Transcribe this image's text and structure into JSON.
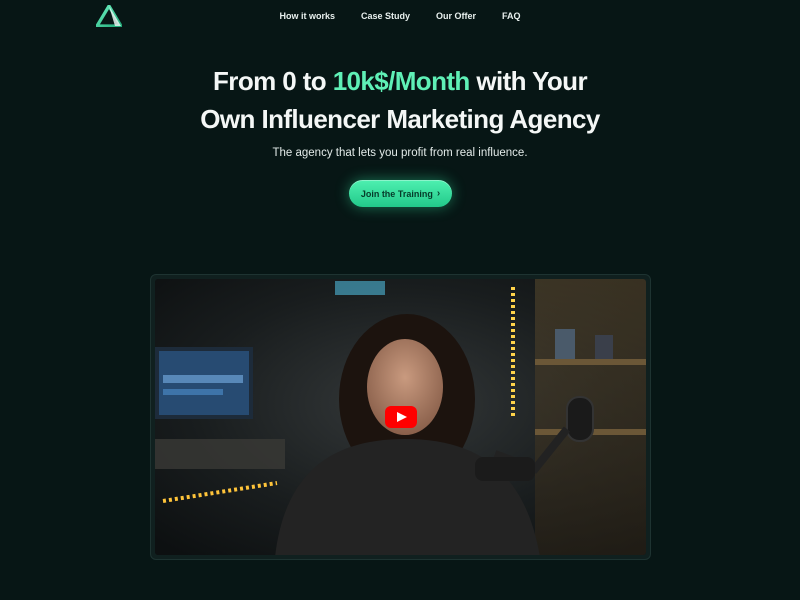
{
  "brand": {
    "logo_icon": "triangle-logo-icon"
  },
  "nav": {
    "items": [
      {
        "label": "How it works"
      },
      {
        "label": "Case Study"
      },
      {
        "label": "Our Offer"
      },
      {
        "label": "FAQ"
      }
    ]
  },
  "hero": {
    "headline_part1": "From 0 to ",
    "headline_accent": "10k$/Month",
    "headline_part2": " with Your",
    "headline_line2": "Own Influencer Marketing Agency",
    "subheadline": "The agency that lets you profit from real influence.",
    "cta_label": "Join the Training",
    "cta_icon": "chevron-right-icon"
  },
  "video": {
    "play_icon": "youtube-play-icon"
  },
  "colors": {
    "background": "#071615",
    "accent": "#5ff0b6",
    "cta": "#34dd9c",
    "play": "#ff0000"
  }
}
